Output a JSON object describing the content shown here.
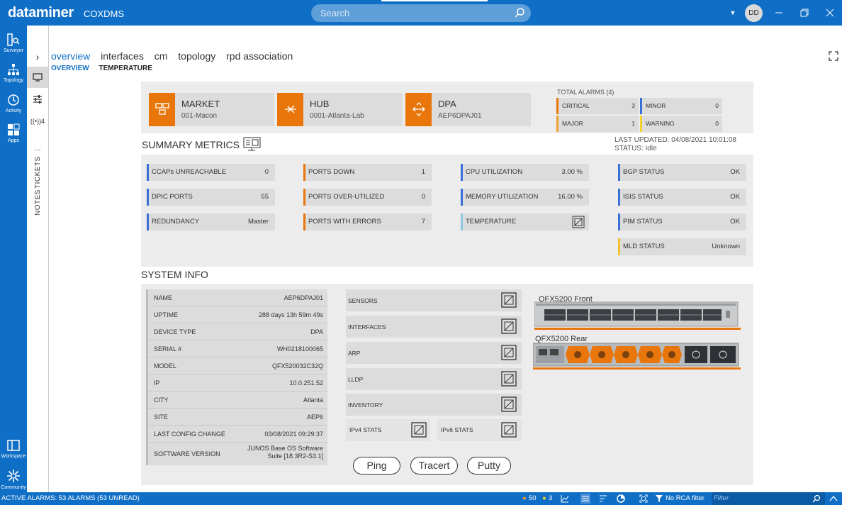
{
  "app": {
    "brand": "dataminer",
    "name": "COXDMS",
    "user_initials": "DD"
  },
  "search": {
    "placeholder": "Search"
  },
  "leftnav": [
    {
      "label": "Surveyor",
      "icon": "surveyor-icon"
    },
    {
      "label": "Topology",
      "icon": "topology-icon"
    },
    {
      "label": "Activity",
      "icon": "activity-icon"
    },
    {
      "label": "Apps",
      "icon": "apps-icon"
    },
    {
      "label": "Workspace",
      "icon": "workspace-icon"
    },
    {
      "label": "Community",
      "icon": "community-icon"
    }
  ],
  "side_panel": {
    "signal": "((•))4",
    "more": "...",
    "tickets": "TICKETS",
    "notes": "NOTES"
  },
  "tabs": [
    "overview",
    "interfaces",
    "cm",
    "topology",
    "rpd association"
  ],
  "subtabs": [
    "OVERVIEW",
    "TEMPERATURE"
  ],
  "header_cards": [
    {
      "title": "MARKET",
      "sub": "001-Macon"
    },
    {
      "title": "HUB",
      "sub": "0001-Atlanta-Lab"
    },
    {
      "title": "DPA",
      "sub": "AEP6DPAJ01"
    }
  ],
  "alarms": {
    "title": "TOTAL ALARMS (4)",
    "items": [
      {
        "label": "CRITICAL",
        "value": "3",
        "color": "#e8760a"
      },
      {
        "label": "MINOR",
        "value": "0",
        "color": "#3b6fd8"
      },
      {
        "label": "MAJOR",
        "value": "1",
        "color": "#f0a030"
      },
      {
        "label": "WARNING",
        "value": "0",
        "color": "#f2d22e"
      }
    ]
  },
  "summary": {
    "title": "SUMMARY METRICS",
    "updated": "LAST UPDATED: 04/08/2021 10:01:08",
    "status": "STATUS: Idle",
    "metrics": [
      {
        "label": "CCAPs UNREACHABLE",
        "value": "0",
        "color": "#3b6fd8"
      },
      {
        "label": "DPIC PORTS",
        "value": "55",
        "color": "#3b6fd8"
      },
      {
        "label": "REDUNDANCY",
        "value": "Master",
        "color": "#3b6fd8"
      },
      {
        "label": "PORTS DOWN",
        "value": "1",
        "color": "#e8760a"
      },
      {
        "label": "PORTS OVER-UTILIZED",
        "value": "0",
        "color": "#e8760a"
      },
      {
        "label": "PORTS WITH ERRORS",
        "value": "7",
        "color": "#e8760a"
      },
      {
        "label": "CPU UTILIZATION",
        "value": "3.00 %",
        "color": "#3b6fd8"
      },
      {
        "label": "MEMORY UTILIZATION",
        "value": "16.00 %",
        "color": "#3b6fd8"
      },
      {
        "label": "TEMPERATURE",
        "value": "",
        "color": "#8ec8e0"
      },
      {
        "label": "BGP STATUS",
        "value": "OK",
        "color": "#3b6fd8"
      },
      {
        "label": "ISIS STATUS",
        "value": "OK",
        "color": "#3b6fd8"
      },
      {
        "label": "PIM STATUS",
        "value": "OK",
        "color": "#3b6fd8"
      },
      {
        "label": "MLD STATUS",
        "value": "Unknown",
        "color": "#f2c230"
      }
    ]
  },
  "system": {
    "title": "SYSTEM INFO",
    "rows": [
      {
        "label": "NAME",
        "value": "AEP6DPAJ01"
      },
      {
        "label": "UPTIME",
        "value": "288 days 13h 59m 49s"
      },
      {
        "label": "DEVICE TYPE",
        "value": "DPA"
      },
      {
        "label": "SERIAL #",
        "value": "WH0218100065"
      },
      {
        "label": "MODEL",
        "value": "QFX520032C32Q"
      },
      {
        "label": "IP",
        "value": "10.0.251.52"
      },
      {
        "label": "CITY",
        "value": "Atlanta"
      },
      {
        "label": "SITE",
        "value": "AEP6"
      },
      {
        "label": "LAST CONFIG CHANGE",
        "value": "03/08/2021 09:29:37"
      },
      {
        "label": "SOFTWARE VERSION",
        "value": "JUNOS Base OS Software Suite [18.3R2-S3.1]"
      }
    ],
    "links": [
      "SENSORS",
      "INTERFACES",
      "ARP",
      "LLDP",
      "INVENTORY"
    ],
    "small_links": [
      "IPv4 STATS",
      "IPv6 STATS"
    ],
    "buttons": [
      "Ping",
      "Tracert",
      "Putty"
    ],
    "hardware": [
      "QFX5200 Front",
      "QFX5200 Rear"
    ]
  },
  "statusbar": {
    "alarms": "ACTIVE ALARMS: 53 ALARMS (53 UNREAD)",
    "count_orange": "50",
    "count_yellow": "3",
    "rca": "No RCA filter",
    "filter_placeholder": "Filter"
  }
}
